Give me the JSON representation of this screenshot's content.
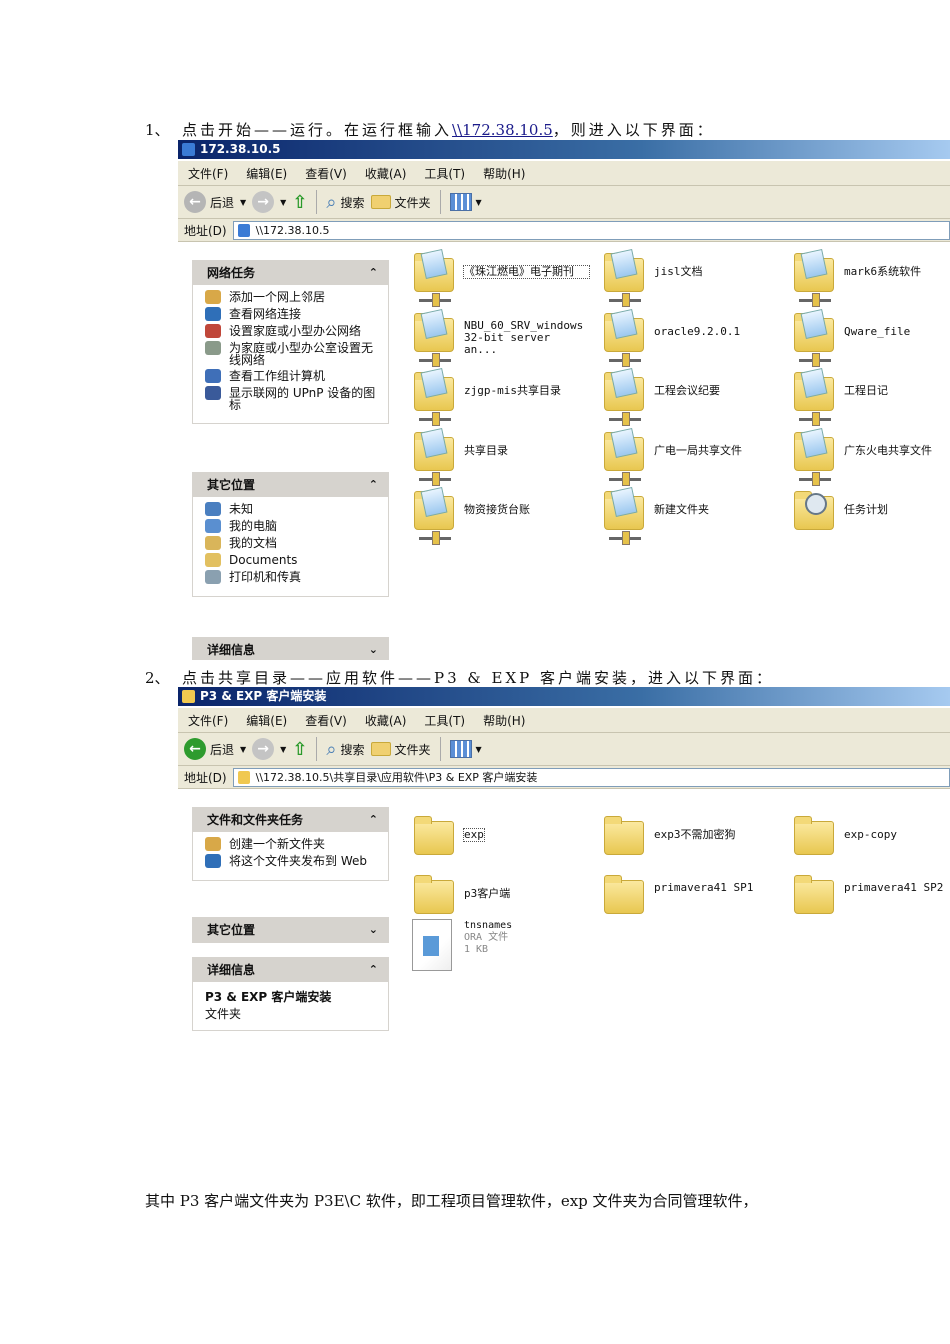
{
  "step1": {
    "num": "1、",
    "text": "点击开始——运行。在运行框输入",
    "link": "\\\\172.38.10.5",
    "after": "，则进入以下界面："
  },
  "step2": {
    "num": "2、",
    "text": "点击共享目录——应用软件——P3 & EXP 客户端安装，进入以下界面："
  },
  "footer": "其中 P3 客户端文件夹为 P3E\\C 软件，即工程项目管理软件，exp 文件夹为合同管理软件，",
  "menu": [
    "文件(F)",
    "编辑(E)",
    "查看(V)",
    "收藏(A)",
    "工具(T)",
    "帮助(H)"
  ],
  "toolbar": {
    "back": "后退",
    "search": "搜索",
    "folders": "文件夹"
  },
  "address_label": "地址(D)",
  "win1": {
    "title": "172.38.10.5",
    "address": "\\\\172.38.10.5",
    "panels": [
      {
        "title": "网络任务",
        "chev": "⌃",
        "items": [
          "添加一个网上邻居",
          "查看网络连接",
          "设置家庭或小型办公网络",
          "为家庭或小型办公室设置无线网络",
          "查看工作组计算机",
          "显示联网的 UPnP 设备的图标"
        ]
      },
      {
        "title": "其它位置",
        "chev": "⌃",
        "items": [
          "未知",
          "我的电脑",
          "我的文档",
          "Documents",
          "打印机和传真"
        ]
      },
      {
        "title": "详细信息",
        "chev": "⌄",
        "items": []
      }
    ],
    "items": [
      "《珠江燃电》电子期刊",
      "jisl文档",
      "mark6系统软件",
      "NBU_60_SRV_windows 32-bit server an...",
      "oracle9.2.0.1",
      "Qware_file",
      "zjgp-mis共享目录",
      "工程会议纪要",
      "工程日记",
      "共享目录",
      "广电一局共享文件",
      "广东火电共享文件",
      "物资接货台账",
      "新建文件夹",
      "任务计划"
    ]
  },
  "win2": {
    "title": "P3 & EXP 客户端安装",
    "address": "\\\\172.38.10.5\\共享目录\\应用软件\\P3 & EXP 客户端安装",
    "panels": [
      {
        "title": "文件和文件夹任务",
        "chev": "⌃",
        "items": [
          "创建一个新文件夹",
          "将这个文件夹发布到 Web"
        ]
      },
      {
        "title": "其它位置",
        "chev": "⌄",
        "items": []
      },
      {
        "title": "详细信息",
        "chev": "⌃",
        "items": [],
        "detail_name": "P3 & EXP 客户端安装",
        "detail_type": "文件夹"
      }
    ],
    "items": [
      "exp",
      "exp3不需加密狗",
      "exp-copy",
      "p3客户端",
      "primavera41 SP1",
      "primavera41 SP2"
    ],
    "file": {
      "name": "tnsnames",
      "type": "ORA 文件",
      "size": "1 KB"
    }
  }
}
